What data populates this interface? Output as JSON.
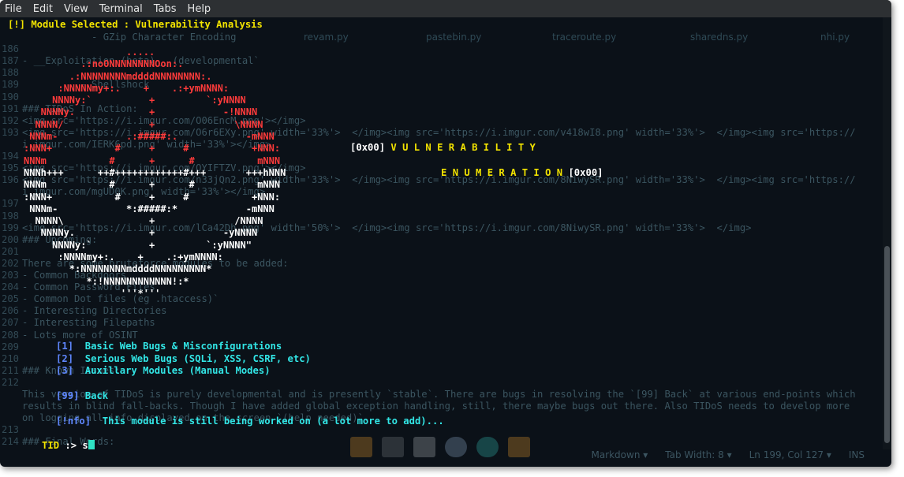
{
  "menu": [
    "File",
    "Edit",
    "View",
    "Terminal",
    "Tabs",
    "Help"
  ],
  "background_tabs": [
    "revam.py",
    "pastebin.py",
    "traceroute.py",
    "sharedns.py",
    "nhi.py"
  ],
  "background_lines": [
    {
      "n": "",
      "t": "            - GZip Character Encoding"
    },
    {
      "n": "186",
      "t": ""
    },
    {
      "n": "187",
      "t": "- __Exploitation (beta)__ (developmental`"
    },
    {
      "n": "188",
      "t": ""
    },
    {
      "n": "189",
      "t": "          - Shellshock"
    },
    {
      "n": "190",
      "t": ""
    },
    {
      "n": "191",
      "t": "### TIDoS In Action:"
    },
    {
      "n": "192",
      "t": "<img src='https://i.imgur.com/O06EncM.png'></img>"
    },
    {
      "n": "193",
      "t": "<img src='https://i.imgur.com/O6r6EXy.png' width='33%'>  </img><img src='https://i.imgur.com/v418wI8.png' width='33%'>  </img><img src='https://"
    },
    {
      "n": "",
      "t": "i.imgur.com/IERK6pd.png' width='33%'></img>"
    },
    {
      "n": "194",
      "t": ""
    },
    {
      "n": "195",
      "t": "<img src='https://i.imgur.com/OYIFTZV.png'></img>"
    },
    {
      "n": "196",
      "t": "<img src='https://i.imgur.com/n33jQn2.png' width='33%'>  </img><img src='https://i.imgur.com/8NiwySR.png' width='33%'>  </img><img src='https://"
    },
    {
      "n": "",
      "t": "i.imgur.com/mgUD0K.png' width='33%'></img>"
    },
    {
      "n": "197",
      "t": ""
    },
    {
      "n": "198",
      "t": ""
    },
    {
      "n": "199",
      "t": "<img src='https://i.imgur.com/lCa42Dh.png' width='50%'>  </img><img src='https://i.imgur.com/8NiwySR.png' width='33%'>  </img>"
    },
    {
      "n": "200",
      "t": "### Upcoming:"
    },
    {
      "n": "201",
      "t": ""
    },
    {
      "n": "202",
      "t": "There are some bruteforce modules to be added:"
    },
    {
      "n": "203",
      "t": "- Common Backdoors"
    },
    {
      "n": "204",
      "t": "- Common Password Files"
    },
    {
      "n": "205",
      "t": "- Common Dot files (eg .htaccess)`"
    },
    {
      "n": "206",
      "t": "- Interesting Directories"
    },
    {
      "n": "207",
      "t": "- Interesting Filepaths"
    },
    {
      "n": "208",
      "t": "- Lots more of OSINT"
    },
    {
      "n": "209",
      "t": ""
    },
    {
      "n": "210",
      "t": ""
    },
    {
      "n": "211",
      "t": "### Known Issues:"
    },
    {
      "n": "212",
      "t": ""
    },
    {
      "n": "",
      "t": "This version of TIDoS is purely developmental and is presently `stable`. There are bugs in resolving the `[99] Back` at various end-points which"
    },
    {
      "n": "",
      "t": "results in blind fall-backs. Though I have added global exception handling, still, there maybe bugs out there. Also TIDoS needs to develop more"
    },
    {
      "n": "",
      "t": "on logging all info displayed on the screen `(help needed)`."
    },
    {
      "n": "213",
      "t": ""
    },
    {
      "n": "214",
      "t": "### Final Words:"
    },
    {
      "n": "",
      "t": ""
    }
  ],
  "module_header": "[!] Module Selected : Vulnerability Analysis",
  "ascii_art": [
    "                  .....",
    "          .:noONNNNNNNNOon:.",
    "        .:NNNNNNNNmddddNNNNNNNN:.",
    "      :NNNNNmy+:.    +    .:+ymNNNN:",
    "     NNNNy:`          +         `:yNNNN",
    "   NNNNy.             +            -!NNNN",
    "  NNNN/               +              \\NNNN",
    " NNNm-            .:#####:.            -mNNN",
    ":NNN+           #     +     #           +NNN:",
    "NNNm           #      +      #           mNNN",
    "NNNh+++      ++#++++++++++++#+++       +++hNNN",
    "NNNm           #      +      #           mNNN",
    ":NNN+           #     +     #           +NNN:",
    " NNNm-            *:#####:*            -mNNN",
    "  NNNN\\               +              /NNNN",
    "   NNNNy.             +            -yNNNN",
    "     NNNNy:`          +         `:yNNNN\"",
    "      :NNNNmy+:.    +    .:+ymNNNN:",
    "        *:NNNNNNNNmddddNNNNNNNNN*",
    "           *:!NNNNNNNNNNNN!:*",
    "                 '''*'''"
  ],
  "title_line1": "[0x00] V U L N E R A B I L I T Y",
  "title_line2": "E N U M E R A T I O N [0x00]",
  "options": [
    {
      "key": "[1]",
      "label": "Basic Web Bugs & Misconfigurations"
    },
    {
      "key": "[2]",
      "label": "Serious Web Bugs (SQLi, XSS, CSRF, etc)"
    },
    {
      "key": "[3]",
      "label": "Auxillary Modules (Manual Modes)"
    }
  ],
  "back_key": "[99]",
  "back_label": "Back",
  "info_tag": "[!nfo]",
  "info_text": "This module is still being worked on (a lot more to add)...",
  "prompt_label": "TID",
  "prompt_symbol": ":>",
  "prompt_input": "s",
  "status": {
    "language": "Markdown ▾",
    "tab_width": "Tab Width: 8 ▾",
    "position": "Ln 199, Col 127 ▾",
    "mode": "INS"
  },
  "colors": {
    "terminal_bg": "#0b1118",
    "yellow": "#f2e300",
    "cyan": "#32e6e6",
    "blue": "#5f87ff",
    "red": "#ff3b3b"
  }
}
